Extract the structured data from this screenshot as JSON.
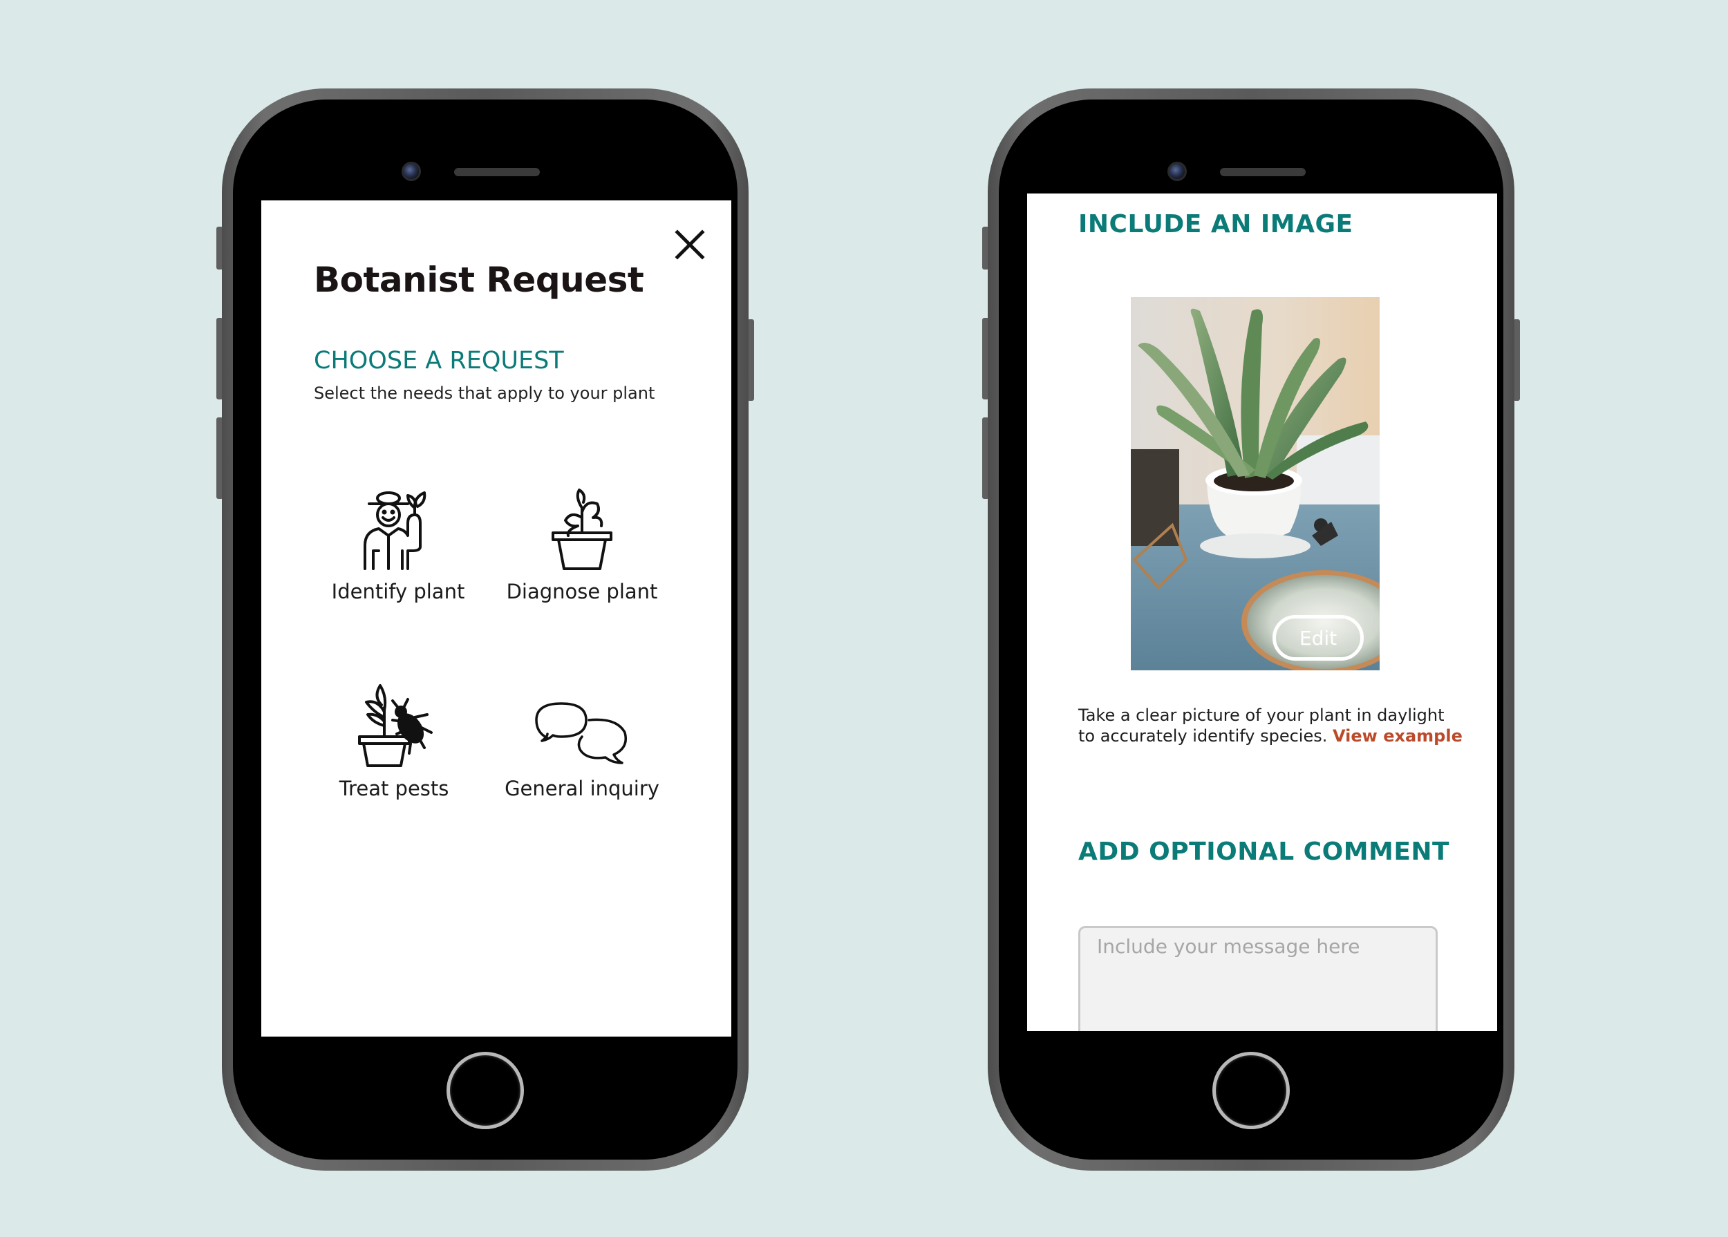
{
  "left_screen": {
    "title": "Botanist Request",
    "close_icon": "close-x-icon",
    "section_heading": "CHOOSE A REQUEST",
    "section_subtitle": "Select the needs that apply to your plant",
    "options": [
      {
        "label": "Identify plant",
        "icon": "gardener-icon"
      },
      {
        "label": "Diagnose plant",
        "icon": "wilting-plant-icon"
      },
      {
        "label": "Treat pests",
        "icon": "plant-bug-icon"
      },
      {
        "label": "General inquiry",
        "icon": "chat-bubbles-icon"
      }
    ]
  },
  "right_screen": {
    "image_heading": "INCLUDE AN IMAGE",
    "edit_label": "Edit",
    "caption_line1": "Take a clear picture of your plant in daylight",
    "caption_line2": "to accurately identify species.",
    "view_example_link": "View example",
    "comment_heading": "ADD OPTIONAL COMMENT",
    "comment_placeholder": "Include your message here"
  },
  "colors": {
    "background": "#dbeae9",
    "accent_teal": "#0b7b78",
    "link_red": "#bb4a2b",
    "title_dark": "#1a1414"
  }
}
